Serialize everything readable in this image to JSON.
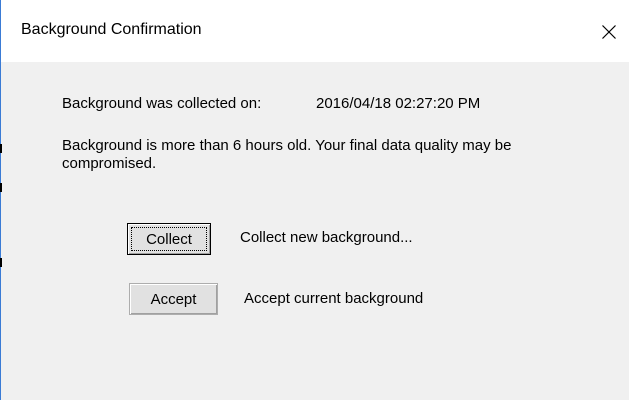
{
  "window": {
    "title": "Background Confirmation",
    "close_icon": "close-icon"
  },
  "content": {
    "collected_label": "Background was collected on:",
    "collected_datetime": "2016/04/18  02:27:20 PM",
    "warning_text": "Background is more than 6 hours old.  Your final data quality may be compromised."
  },
  "actions": {
    "collect_label": "Collect",
    "collect_description": "Collect new background...",
    "accept_label": "Accept",
    "accept_description": "Accept current background"
  },
  "colors": {
    "dialog_background": "#f0f0f0",
    "title_bar_background": "#ffffff",
    "window_border": "#3a7bd5",
    "button_face": "#e1e1e1"
  }
}
